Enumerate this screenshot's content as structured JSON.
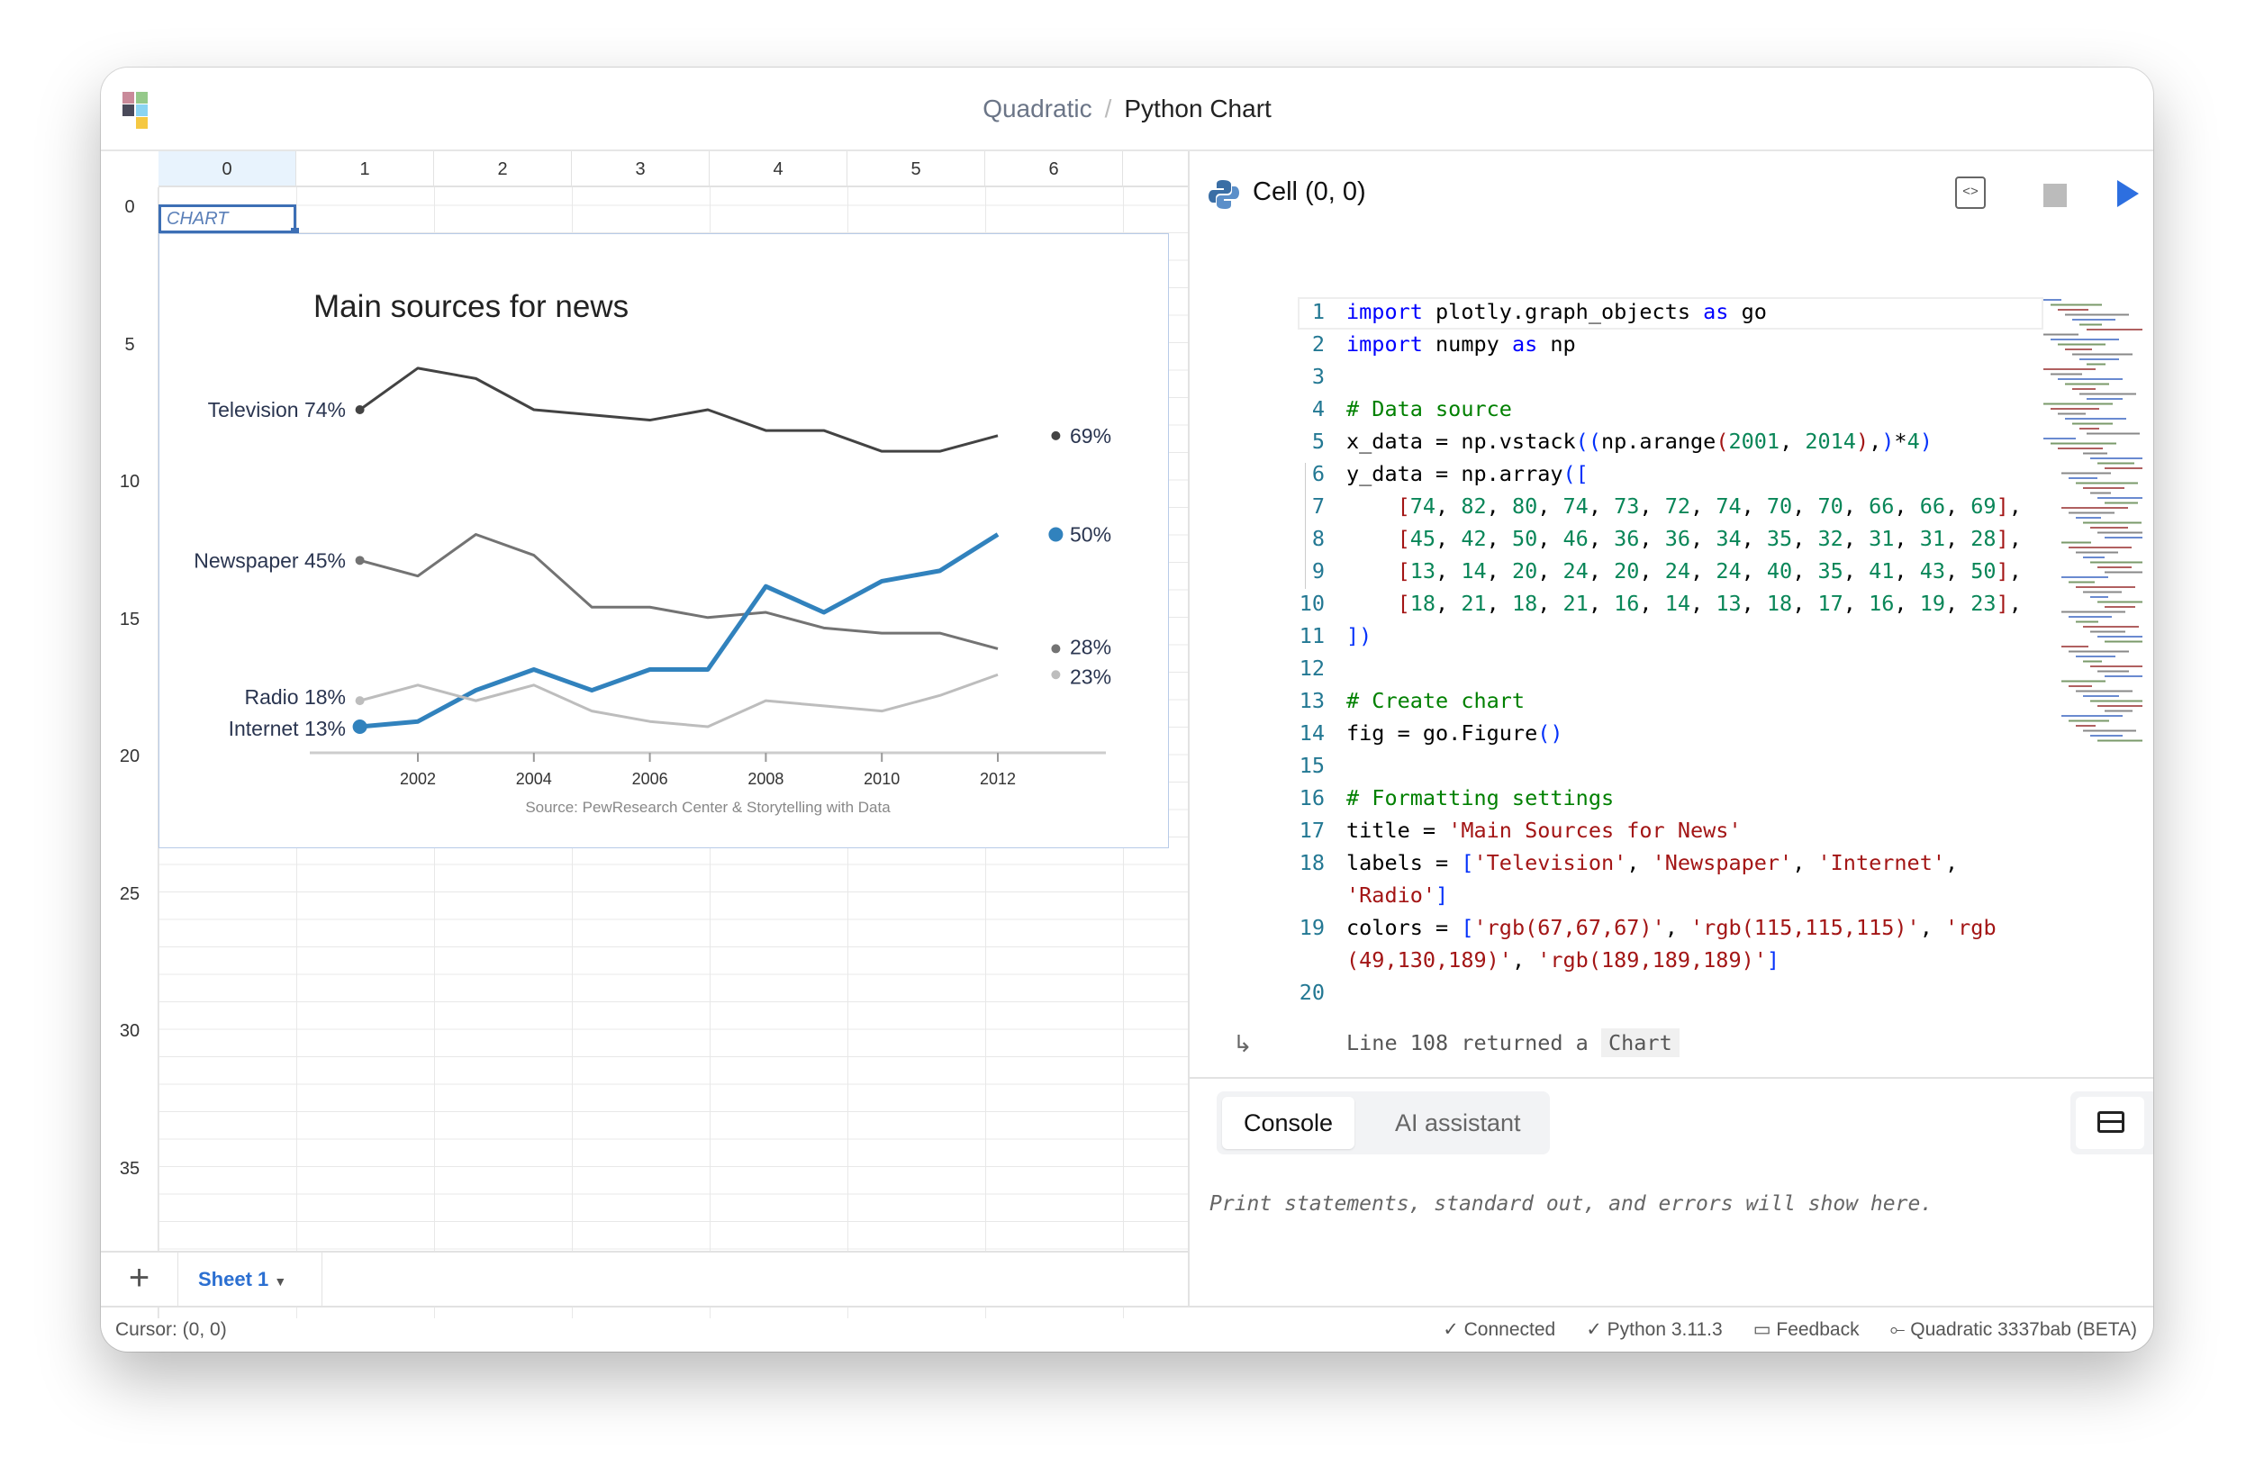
{
  "header": {
    "app": "Quadratic",
    "separator": "/",
    "doc": "Python Chart"
  },
  "grid": {
    "columns": [
      "0",
      "1",
      "2",
      "3",
      "4",
      "5",
      "6"
    ],
    "row_labels": [
      "0",
      "5",
      "10",
      "15",
      "20",
      "25",
      "30",
      "35"
    ],
    "cursor_cell_text": "CHART"
  },
  "sheets": {
    "add_label": "+",
    "tabs": [
      {
        "label": "Sheet 1",
        "active": true
      }
    ]
  },
  "status": {
    "cursor": "Cursor: (0, 0)",
    "items": [
      "✓ Connected",
      "✓ Python 3.11.3",
      "Feedback",
      "Quadratic 3337bab (BETA)"
    ]
  },
  "editor": {
    "cell_title": "Cell (0, 0)",
    "lines": [
      {
        "n": "1",
        "t": [
          [
            "k",
            "import"
          ],
          [
            "t",
            " plotly.graph_objects "
          ],
          [
            "k",
            "as"
          ],
          [
            "t",
            " go"
          ]
        ]
      },
      {
        "n": "2",
        "t": [
          [
            "k",
            "import"
          ],
          [
            "t",
            " numpy "
          ],
          [
            "k",
            "as"
          ],
          [
            "t",
            " np"
          ]
        ]
      },
      {
        "n": "3",
        "t": []
      },
      {
        "n": "4",
        "t": [
          [
            "c",
            "# Data source"
          ]
        ]
      },
      {
        "n": "5",
        "t": [
          [
            "t",
            "x_data = np.vstack"
          ],
          [
            "b",
            "(("
          ],
          [
            "t",
            "np.arange"
          ],
          [
            "s",
            "("
          ],
          [
            "n",
            "2001"
          ],
          [
            "t",
            ", "
          ],
          [
            "n",
            "2014"
          ],
          [
            "s",
            ")"
          ],
          [
            "t",
            ","
          ],
          [
            "b",
            ")"
          ],
          [
            "t",
            "*"
          ],
          [
            "n",
            "4"
          ],
          [
            "b",
            ")"
          ]
        ]
      },
      {
        "n": "6",
        "t": [
          [
            "t",
            "y_data = np.array"
          ],
          [
            "b",
            "(["
          ]
        ]
      },
      {
        "n": "7",
        "t": [
          [
            "t",
            "    "
          ],
          [
            "s",
            "["
          ],
          [
            "n",
            "74"
          ],
          [
            "t",
            ", "
          ],
          [
            "n",
            "82"
          ],
          [
            "t",
            ", "
          ],
          [
            "n",
            "80"
          ],
          [
            "t",
            ", "
          ],
          [
            "n",
            "74"
          ],
          [
            "t",
            ", "
          ],
          [
            "n",
            "73"
          ],
          [
            "t",
            ", "
          ],
          [
            "n",
            "72"
          ],
          [
            "t",
            ", "
          ],
          [
            "n",
            "74"
          ],
          [
            "t",
            ", "
          ],
          [
            "n",
            "70"
          ],
          [
            "t",
            ", "
          ],
          [
            "n",
            "70"
          ],
          [
            "t",
            ", "
          ],
          [
            "n",
            "66"
          ],
          [
            "t",
            ", "
          ],
          [
            "n",
            "66"
          ],
          [
            "t",
            ", "
          ],
          [
            "n",
            "69"
          ],
          [
            "s",
            "]"
          ],
          [
            "t",
            ","
          ]
        ]
      },
      {
        "n": "8",
        "t": [
          [
            "t",
            "    "
          ],
          [
            "s",
            "["
          ],
          [
            "n",
            "45"
          ],
          [
            "t",
            ", "
          ],
          [
            "n",
            "42"
          ],
          [
            "t",
            ", "
          ],
          [
            "n",
            "50"
          ],
          [
            "t",
            ", "
          ],
          [
            "n",
            "46"
          ],
          [
            "t",
            ", "
          ],
          [
            "n",
            "36"
          ],
          [
            "t",
            ", "
          ],
          [
            "n",
            "36"
          ],
          [
            "t",
            ", "
          ],
          [
            "n",
            "34"
          ],
          [
            "t",
            ", "
          ],
          [
            "n",
            "35"
          ],
          [
            "t",
            ", "
          ],
          [
            "n",
            "32"
          ],
          [
            "t",
            ", "
          ],
          [
            "n",
            "31"
          ],
          [
            "t",
            ", "
          ],
          [
            "n",
            "31"
          ],
          [
            "t",
            ", "
          ],
          [
            "n",
            "28"
          ],
          [
            "s",
            "]"
          ],
          [
            "t",
            ","
          ]
        ]
      },
      {
        "n": "9",
        "t": [
          [
            "t",
            "    "
          ],
          [
            "s",
            "["
          ],
          [
            "n",
            "13"
          ],
          [
            "t",
            ", "
          ],
          [
            "n",
            "14"
          ],
          [
            "t",
            ", "
          ],
          [
            "n",
            "20"
          ],
          [
            "t",
            ", "
          ],
          [
            "n",
            "24"
          ],
          [
            "t",
            ", "
          ],
          [
            "n",
            "20"
          ],
          [
            "t",
            ", "
          ],
          [
            "n",
            "24"
          ],
          [
            "t",
            ", "
          ],
          [
            "n",
            "24"
          ],
          [
            "t",
            ", "
          ],
          [
            "n",
            "40"
          ],
          [
            "t",
            ", "
          ],
          [
            "n",
            "35"
          ],
          [
            "t",
            ", "
          ],
          [
            "n",
            "41"
          ],
          [
            "t",
            ", "
          ],
          [
            "n",
            "43"
          ],
          [
            "t",
            ", "
          ],
          [
            "n",
            "50"
          ],
          [
            "s",
            "]"
          ],
          [
            "t",
            ","
          ]
        ]
      },
      {
        "n": "10",
        "t": [
          [
            "t",
            "    "
          ],
          [
            "s",
            "["
          ],
          [
            "n",
            "18"
          ],
          [
            "t",
            ", "
          ],
          [
            "n",
            "21"
          ],
          [
            "t",
            ", "
          ],
          [
            "n",
            "18"
          ],
          [
            "t",
            ", "
          ],
          [
            "n",
            "21"
          ],
          [
            "t",
            ", "
          ],
          [
            "n",
            "16"
          ],
          [
            "t",
            ", "
          ],
          [
            "n",
            "14"
          ],
          [
            "t",
            ", "
          ],
          [
            "n",
            "13"
          ],
          [
            "t",
            ", "
          ],
          [
            "n",
            "18"
          ],
          [
            "t",
            ", "
          ],
          [
            "n",
            "17"
          ],
          [
            "t",
            ", "
          ],
          [
            "n",
            "16"
          ],
          [
            "t",
            ", "
          ],
          [
            "n",
            "19"
          ],
          [
            "t",
            ", "
          ],
          [
            "n",
            "23"
          ],
          [
            "s",
            "]"
          ],
          [
            "t",
            ","
          ]
        ]
      },
      {
        "n": "11",
        "t": [
          [
            "b",
            "])"
          ]
        ]
      },
      {
        "n": "12",
        "t": []
      },
      {
        "n": "13",
        "t": [
          [
            "c",
            "# Create chart"
          ]
        ]
      },
      {
        "n": "14",
        "t": [
          [
            "t",
            "fig = go.Figure"
          ],
          [
            "b",
            "()"
          ]
        ]
      },
      {
        "n": "15",
        "t": []
      },
      {
        "n": "16",
        "t": [
          [
            "c",
            "# Formatting settings"
          ]
        ]
      },
      {
        "n": "17",
        "t": [
          [
            "t",
            "title = "
          ],
          [
            "s",
            "'Main Sources for News'"
          ]
        ]
      },
      {
        "n": "18",
        "t": [
          [
            "t",
            "labels = "
          ],
          [
            "b",
            "["
          ],
          [
            "s",
            "'Television'"
          ],
          [
            "t",
            ", "
          ],
          [
            "s",
            "'Newspaper'"
          ],
          [
            "t",
            ", "
          ],
          [
            "s",
            "'Internet'"
          ],
          [
            "t",
            ","
          ],
          [
            "br",
            ""
          ],
          [
            "s",
            "'Radio'"
          ],
          [
            "b",
            "]"
          ]
        ]
      },
      {
        "n": "19",
        "t": [
          [
            "t",
            "colors = "
          ],
          [
            "b",
            "["
          ],
          [
            "s",
            "'rgb(67,67,67)'"
          ],
          [
            "t",
            ", "
          ],
          [
            "s",
            "'rgb(115,115,115)'"
          ],
          [
            "t",
            ", "
          ],
          [
            "s",
            "'rgb"
          ],
          [
            "br",
            ""
          ],
          [
            "s",
            "(49,130,189)'"
          ],
          [
            "t",
            ", "
          ],
          [
            "s",
            "'rgb(189,189,189)'"
          ],
          [
            "b",
            "]"
          ]
        ]
      },
      {
        "n": "20",
        "t": []
      }
    ],
    "return_text": "Line 108 returned a",
    "return_type": "Chart"
  },
  "console": {
    "tabs": [
      "Console",
      "AI assistant"
    ],
    "active": "Console",
    "placeholder": "Print statements, standard out, and errors will show here."
  },
  "chart_data": {
    "type": "line",
    "title": "Main sources for news",
    "source": "Source: PewResearch Center & Storytelling with Data",
    "x": [
      2001,
      2002,
      2003,
      2004,
      2005,
      2006,
      2007,
      2008,
      2009,
      2010,
      2011,
      2012
    ],
    "xticks": [
      "2002",
      "2004",
      "2006",
      "2008",
      "2010",
      "2012"
    ],
    "series": [
      {
        "name": "Television",
        "color": "#434343",
        "values": [
          74,
          82,
          80,
          74,
          73,
          72,
          74,
          70,
          70,
          66,
          66,
          69
        ]
      },
      {
        "name": "Newspaper",
        "color": "#737373",
        "values": [
          45,
          42,
          50,
          46,
          36,
          36,
          34,
          35,
          32,
          31,
          31,
          28
        ]
      },
      {
        "name": "Internet",
        "color": "#3182bd",
        "values": [
          13,
          14,
          20,
          24,
          20,
          24,
          24,
          40,
          35,
          41,
          43,
          50
        ]
      },
      {
        "name": "Radio",
        "color": "#bdbdbd",
        "values": [
          18,
          21,
          18,
          21,
          16,
          14,
          13,
          18,
          17,
          16,
          19,
          23
        ]
      }
    ],
    "grid": false,
    "legend": "none (direct labels)"
  }
}
